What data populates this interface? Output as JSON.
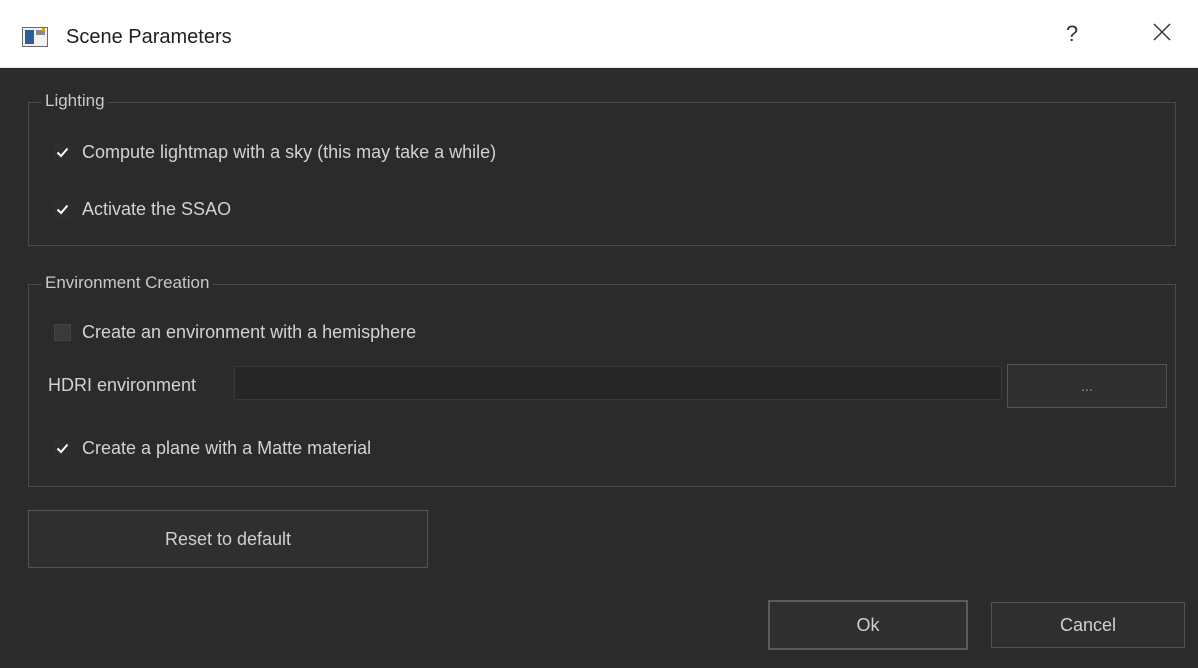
{
  "window": {
    "title": "Scene Parameters",
    "help_label": "?",
    "icons": {
      "app": "app-window-icon",
      "close": "close-icon"
    }
  },
  "lighting": {
    "title": "Lighting",
    "options": [
      {
        "label": "Compute lightmap with a sky (this may take a while)",
        "checked": true
      },
      {
        "label": "Activate the SSAO",
        "checked": true
      }
    ]
  },
  "environment": {
    "title": "Environment Creation",
    "hemisphere": {
      "label": "Create an environment with a hemisphere",
      "checked": false
    },
    "hdri": {
      "label": "HDRI environment",
      "value": "",
      "browse_label": "..."
    },
    "matte_plane": {
      "label": "Create a plane with a Matte material",
      "checked": true
    }
  },
  "buttons": {
    "reset": "Reset to default",
    "ok": "Ok",
    "cancel": "Cancel"
  },
  "colors": {
    "background": "#2b2b2b",
    "titlebar": "#ffffff",
    "text": "#d2d2d2",
    "border": "#4a4a4a"
  }
}
